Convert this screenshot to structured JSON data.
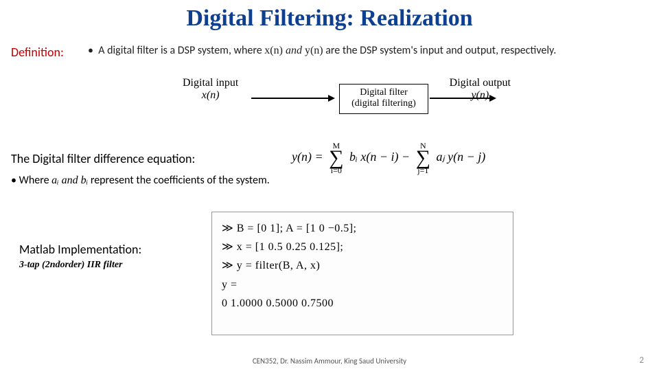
{
  "title": "Digital Filtering: Realization",
  "definition_label": "Definition:",
  "definition_text_pre": "A digital filter is a DSP system, where ",
  "definition_xn": "x(n)",
  "definition_and": " and ",
  "definition_yn": "y(n)",
  "definition_text_post": "  are the DSP system's input and output, respectively.",
  "diagram": {
    "input_top": "Digital input",
    "input_var": "x(n)",
    "box_line1": "Digital filter",
    "box_line2": "(digital filtering)",
    "output_top": "Digital output",
    "output_var": "y(n)"
  },
  "eq_label": "The Digital filter difference equation:",
  "eq": {
    "lhs": "y(n)  =",
    "sum1_top": "M",
    "sum1_bot": "i=0",
    "term1": "bᵢ x(n − i)  −",
    "sum2_top": "N",
    "sum2_bot": "j=1",
    "term2": "aⱼ y(n − j)"
  },
  "coef_pre": "Where ",
  "coef_ai": "aᵢ",
  "coef_and": " and ",
  "coef_bi": "bᵢ",
  "coef_post": "   represent the coefficients of the system.",
  "matlab_label": "Matlab Implementation:",
  "matlab_sub": "3-tap (2ndorder) IIR filter",
  "code": {
    "l1": "≫ B = [0  1]; A = [1  0  −0.5];",
    "l2": "≫ x = [1  0.5  0.25  0.125];",
    "l3": "≫ y = filter(B,   A,   x)",
    "l4": "y =",
    "l5": "0      1.0000      0.5000      0.7500"
  },
  "footer": "CEN352, Dr. Nassim Ammour, King Saud University",
  "page": "2"
}
